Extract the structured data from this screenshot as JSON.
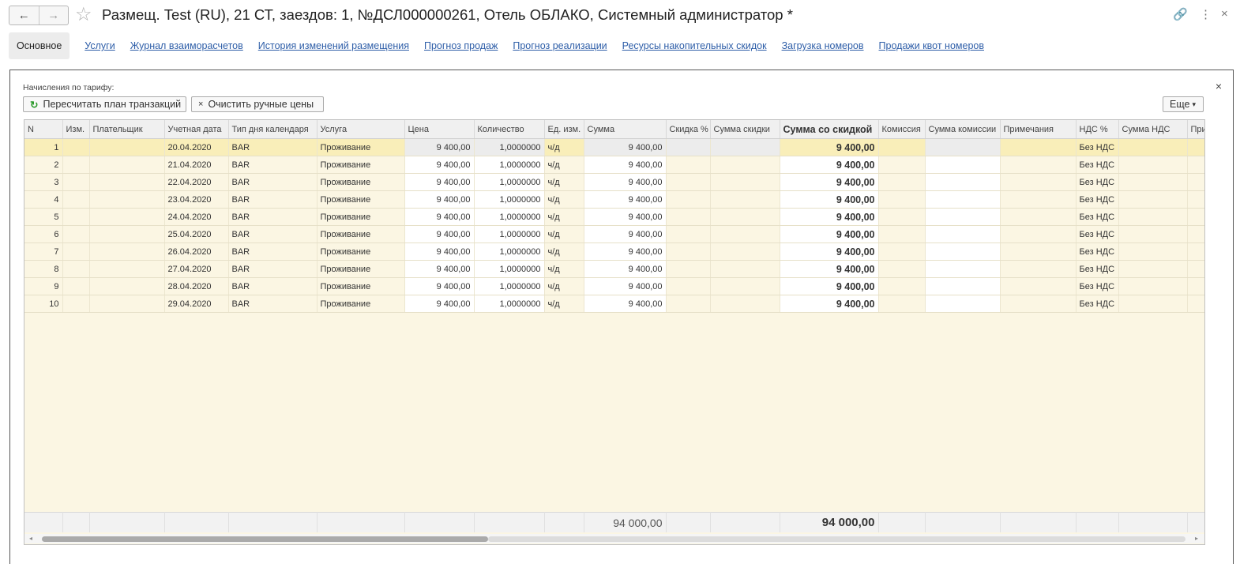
{
  "window": {
    "title": "Размещ. Test (RU), 21 СТ, заездов: 1, №ДСЛ000000261, Отель ОБЛАКО, Системный администратор *",
    "back_icon": "←",
    "forward_icon": "→",
    "star_icon": "☆",
    "link_icon": "🔗",
    "more_icon": "⋮",
    "close_icon": "×"
  },
  "tabs": [
    {
      "label": "Основное"
    },
    {
      "label": "Услуги"
    },
    {
      "label": "Журнал взаиморасчетов"
    },
    {
      "label": "История изменений размещения"
    },
    {
      "label": "Прогноз продаж"
    },
    {
      "label": "Прогноз реализации"
    },
    {
      "label": "Ресурсы накопительных скидок"
    },
    {
      "label": "Загрузка номеров"
    },
    {
      "label": "Продажи квот номеров"
    }
  ],
  "panel": {
    "caption": "Начисления по тарифу:",
    "recalc_label": "Пересчитать план транзакций",
    "recalc_icon": "↻",
    "clear_label": "Очистить ручные цены",
    "clear_icon": "×",
    "more_label": "Еще",
    "more_icon": "▾",
    "close_icon": "×"
  },
  "table": {
    "columns": [
      "N",
      "Изм.",
      "Плательщик",
      "Учетная дата",
      "Тип дня календаря",
      "Услуга",
      "Цена",
      "Количество",
      "Ед. изм.",
      "Сумма",
      "Скидка %",
      "Сумма скидки",
      "Сумма со скидкой",
      "Комиссия",
      "Сумма комиссии",
      "Примечания",
      "НДС %",
      "Сумма НДС",
      "При"
    ],
    "rows": [
      [
        "1",
        "",
        "",
        "20.04.2020",
        "BAR",
        "Проживание",
        "9 400,00",
        "1,0000000",
        "ч/д",
        "9 400,00",
        "",
        "",
        "9 400,00",
        "",
        "",
        "",
        "Без НДС",
        "",
        ""
      ],
      [
        "2",
        "",
        "",
        "21.04.2020",
        "BAR",
        "Проживание",
        "9 400,00",
        "1,0000000",
        "ч/д",
        "9 400,00",
        "",
        "",
        "9 400,00",
        "",
        "",
        "",
        "Без НДС",
        "",
        ""
      ],
      [
        "3",
        "",
        "",
        "22.04.2020",
        "BAR",
        "Проживание",
        "9 400,00",
        "1,0000000",
        "ч/д",
        "9 400,00",
        "",
        "",
        "9 400,00",
        "",
        "",
        "",
        "Без НДС",
        "",
        ""
      ],
      [
        "4",
        "",
        "",
        "23.04.2020",
        "BAR",
        "Проживание",
        "9 400,00",
        "1,0000000",
        "ч/д",
        "9 400,00",
        "",
        "",
        "9 400,00",
        "",
        "",
        "",
        "Без НДС",
        "",
        ""
      ],
      [
        "5",
        "",
        "",
        "24.04.2020",
        "BAR",
        "Проживание",
        "9 400,00",
        "1,0000000",
        "ч/д",
        "9 400,00",
        "",
        "",
        "9 400,00",
        "",
        "",
        "",
        "Без НДС",
        "",
        ""
      ],
      [
        "6",
        "",
        "",
        "25.04.2020",
        "BAR",
        "Проживание",
        "9 400,00",
        "1,0000000",
        "ч/д",
        "9 400,00",
        "",
        "",
        "9 400,00",
        "",
        "",
        "",
        "Без НДС",
        "",
        ""
      ],
      [
        "7",
        "",
        "",
        "26.04.2020",
        "BAR",
        "Проживание",
        "9 400,00",
        "1,0000000",
        "ч/д",
        "9 400,00",
        "",
        "",
        "9 400,00",
        "",
        "",
        "",
        "Без НДС",
        "",
        ""
      ],
      [
        "8",
        "",
        "",
        "27.04.2020",
        "BAR",
        "Проживание",
        "9 400,00",
        "1,0000000",
        "ч/д",
        "9 400,00",
        "",
        "",
        "9 400,00",
        "",
        "",
        "",
        "Без НДС",
        "",
        ""
      ],
      [
        "9",
        "",
        "",
        "28.04.2020",
        "BAR",
        "Проживание",
        "9 400,00",
        "1,0000000",
        "ч/д",
        "9 400,00",
        "",
        "",
        "9 400,00",
        "",
        "",
        "",
        "Без НДС",
        "",
        ""
      ],
      [
        "10",
        "",
        "",
        "29.04.2020",
        "BAR",
        "Проживание",
        "9 400,00",
        "1,0000000",
        "ч/д",
        "9 400,00",
        "",
        "",
        "9 400,00",
        "",
        "",
        "",
        "Без НДС",
        "",
        ""
      ]
    ],
    "totals": [
      "",
      "",
      "",
      "",
      "",
      "",
      "",
      "",
      "",
      "94 000,00",
      "",
      "",
      "94 000,00",
      "",
      "",
      "",
      "",
      "",
      ""
    ],
    "selected_row": 0
  },
  "scrollbar": {
    "left_icon": "◂",
    "right_icon": "▸"
  }
}
